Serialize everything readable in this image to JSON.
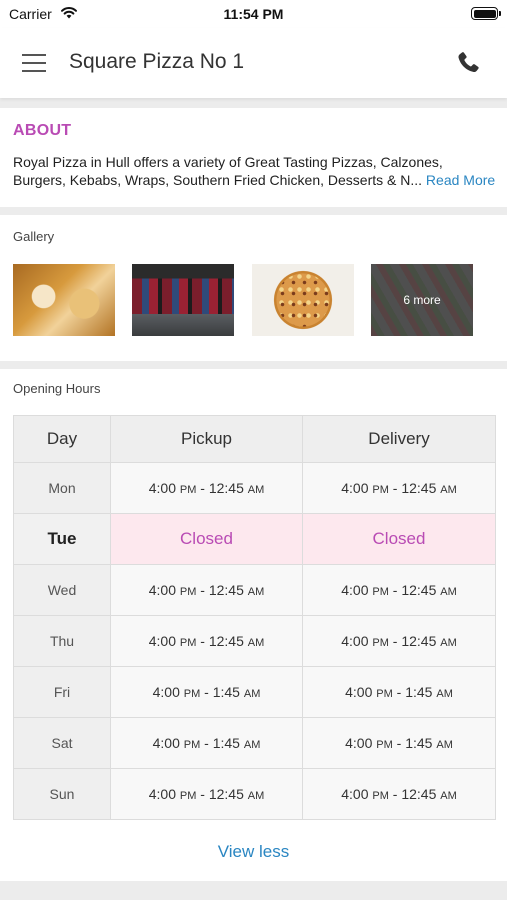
{
  "status_bar": {
    "carrier": "Carrier",
    "time": "11:54 PM"
  },
  "nav": {
    "title": "Square Pizza No 1"
  },
  "about": {
    "heading": "ABOUT",
    "line1": "Royal Pizza in Hull offers a variety of Great Tasting Pizzas, Calzones,",
    "line2": "Burgers, Kebabs, Wraps, Southern Fried Chicken, Desserts & N...",
    "read_more": "Read More"
  },
  "gallery": {
    "label": "Gallery",
    "more_label": "6 more"
  },
  "opening_hours": {
    "label": "Opening Hours",
    "headers": [
      "Day",
      "Pickup",
      "Delivery"
    ],
    "rows": [
      {
        "day": "Mon",
        "pickup_open": "4:00",
        "pickup_close": "12:45",
        "delivery_open": "4:00",
        "delivery_close": "12:45"
      },
      {
        "day": "Tue",
        "pickup": "Closed",
        "delivery": "Closed"
      },
      {
        "day": "Wed",
        "pickup_open": "4:00",
        "pickup_close": "12:45",
        "delivery_open": "4:00",
        "delivery_close": "12:45"
      },
      {
        "day": "Thu",
        "pickup_open": "4:00",
        "pickup_close": "12:45",
        "delivery_open": "4:00",
        "delivery_close": "12:45"
      },
      {
        "day": "Fri",
        "pickup_open": "4:00",
        "pickup_close": "1:45",
        "delivery_open": "4:00",
        "delivery_close": "1:45"
      },
      {
        "day": "Sat",
        "pickup_open": "4:00",
        "pickup_close": "1:45",
        "delivery_open": "4:00",
        "delivery_close": "1:45"
      },
      {
        "day": "Sun",
        "pickup_open": "4:00",
        "pickup_close": "12:45",
        "delivery_open": "4:00",
        "delivery_close": "12:45"
      }
    ],
    "pm": "PM",
    "am": "AM",
    "view_less": "View less"
  },
  "colors": {
    "accent_purple": "#b94bb4",
    "link_blue": "#2a86c2",
    "closed_bg": "#fde8ee"
  },
  "icons": {
    "menu": "hamburger-menu-icon",
    "phone": "phone-icon",
    "wifi": "wifi-icon",
    "battery": "battery-icon"
  }
}
